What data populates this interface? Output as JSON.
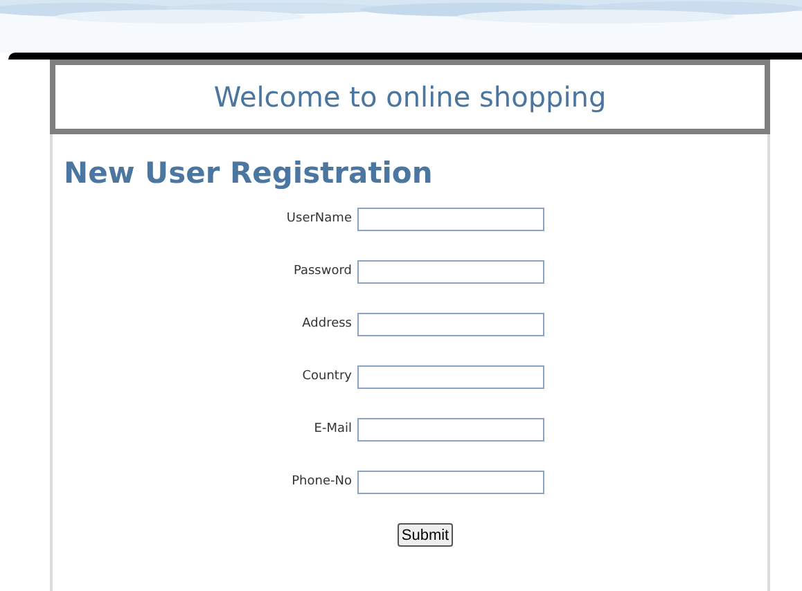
{
  "header": {
    "title": "Welcome to online shopping"
  },
  "form": {
    "title": "New User Registration",
    "fields": [
      {
        "label": "UserName"
      },
      {
        "label": "Password"
      },
      {
        "label": "Address"
      },
      {
        "label": "Country"
      },
      {
        "label": "E-Mail"
      },
      {
        "label": "Phone-No"
      }
    ],
    "submit": "Submit"
  }
}
